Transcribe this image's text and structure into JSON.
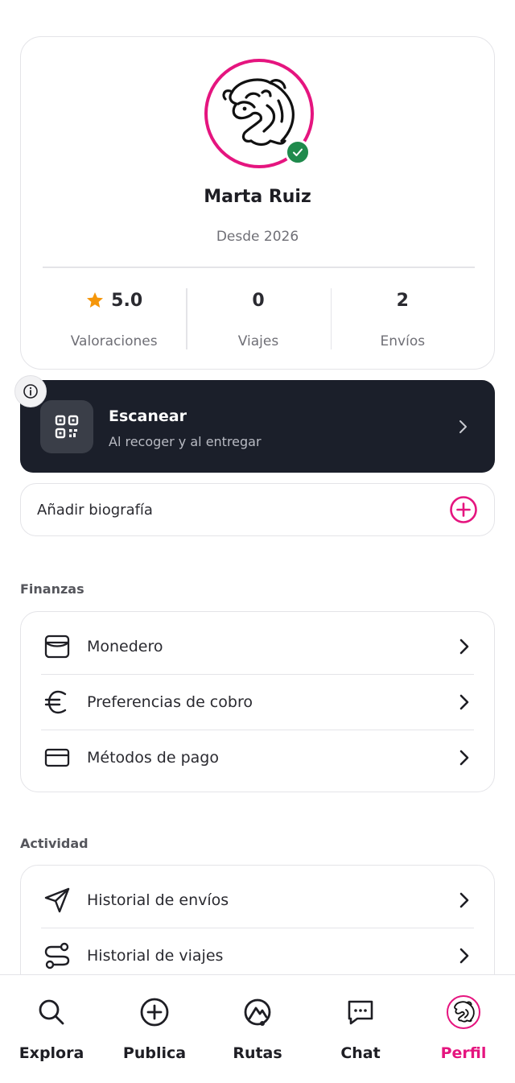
{
  "profile": {
    "name": "Marta Ruiz",
    "since": "Desde 2026",
    "verified_icon": "check-icon",
    "stats": [
      {
        "value": "5.0",
        "label": "Valoraciones",
        "icon": "star-icon"
      },
      {
        "value": "0",
        "label": "Viajes"
      },
      {
        "value": "2",
        "label": "Envíos"
      }
    ]
  },
  "scan": {
    "title": "Escanear",
    "subtitle": "Al recoger y al entregar",
    "icon": "qr-code-icon"
  },
  "bio": {
    "label": "Añadir biografía",
    "icon": "plus-circle-icon"
  },
  "finanzas": {
    "title": "Finanzas",
    "items": [
      {
        "label": "Monedero",
        "icon": "wallet-icon"
      },
      {
        "label": "Preferencias de cobro",
        "icon": "euro-icon"
      },
      {
        "label": "Métodos de pago",
        "icon": "credit-card-icon"
      }
    ]
  },
  "actividad": {
    "title": "Actividad",
    "items": [
      {
        "label": "Historial de envíos",
        "icon": "send-icon"
      },
      {
        "label": "Historial de viajes",
        "icon": "route-icon"
      }
    ]
  },
  "nav": {
    "items": [
      {
        "label": "Explora",
        "icon": "search-icon"
      },
      {
        "label": "Publica",
        "icon": "plus-circle-icon"
      },
      {
        "label": "Rutas",
        "icon": "route-pin-icon"
      },
      {
        "label": "Chat",
        "icon": "chat-icon"
      },
      {
        "label": "Perfil",
        "icon": "avatar",
        "active": true
      }
    ]
  },
  "colors": {
    "accent": "#e5157f",
    "dark_banner": "#1b1f2a",
    "verified": "#1f8a4c",
    "star": "#f5960a"
  }
}
